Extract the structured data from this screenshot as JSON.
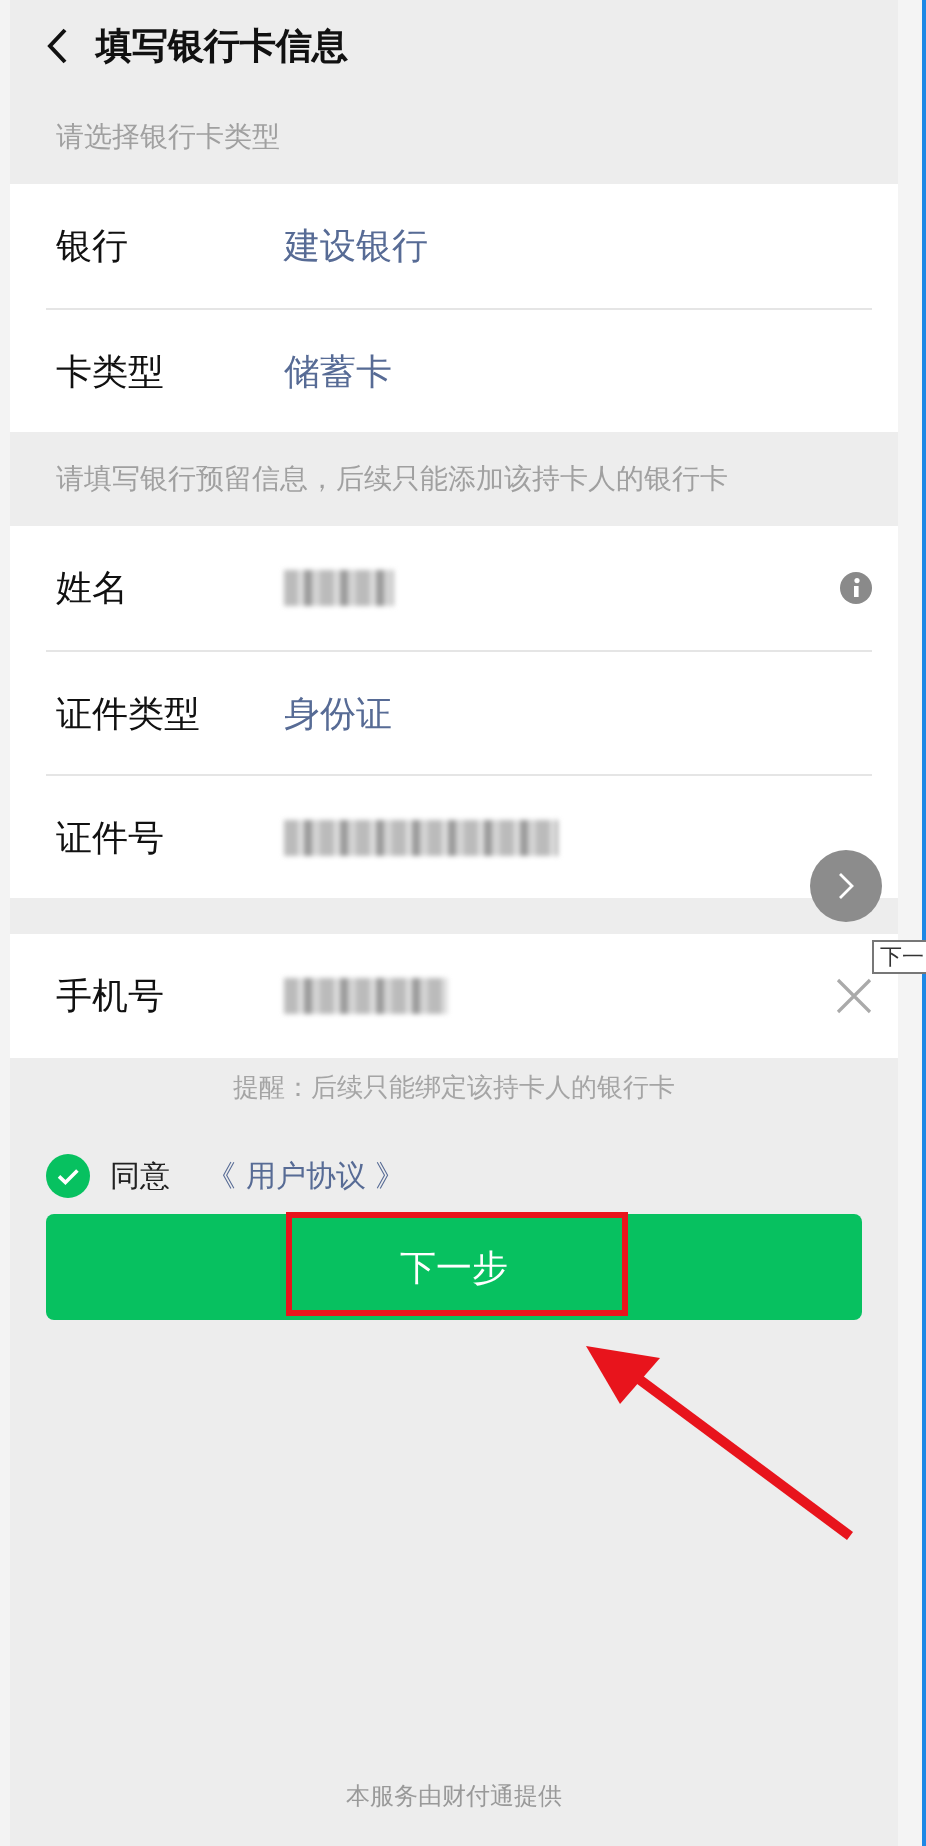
{
  "header": {
    "title": "填写银行卡信息"
  },
  "sections": [
    {
      "caption": "请选择银行卡类型",
      "rows": [
        {
          "label": "银行",
          "kind": "select",
          "value": "建设银行"
        },
        {
          "label": "卡类型",
          "kind": "select",
          "value": "储蓄卡"
        }
      ]
    },
    {
      "caption": "请填写银行预留信息，后续只能添加该持卡人的银行卡",
      "rows": [
        {
          "label": "姓名",
          "kind": "redacted",
          "trailing": {
            "kind": "info"
          }
        },
        {
          "label": "证件类型",
          "kind": "select",
          "value": "身份证"
        },
        {
          "label": "证件号",
          "kind": "redacted"
        }
      ]
    },
    {
      "rows": [
        {
          "label": "手机号",
          "kind": "redacted",
          "trailing": {
            "kind": "clear"
          }
        }
      ]
    }
  ],
  "hint": "提醒：后续只能绑定该持卡人的银行卡",
  "agreement": {
    "checked": true,
    "label": "同意",
    "link": "《 用户协议 》"
  },
  "primary_button": {
    "label": "下一步"
  },
  "footer": "本服务由财付通提供",
  "tooltip": "下一"
}
